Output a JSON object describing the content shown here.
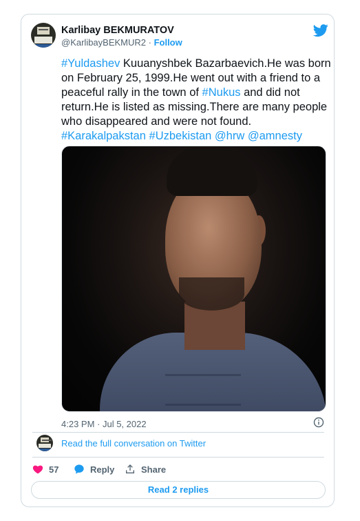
{
  "tweet": {
    "author_name": "Karlibay BEKMURATOV",
    "handle": "@KarlibayBEKMUR2",
    "separator": " · ",
    "follow_label": "Follow",
    "text_parts": [
      {
        "text": "#Yuldashev",
        "tag": true
      },
      {
        "text": " Kuuanyshbek Bazarbaevich.He was born on February 25, 1999.He went out with a friend to a peaceful rally in the town of ",
        "tag": false
      },
      {
        "text": "#Nukus",
        "tag": true
      },
      {
        "text": " and did not return.He is listed as missing.There are many people who disappeared and were not found. ",
        "tag": false
      },
      {
        "text": "#Karakalpakstan",
        "tag": true
      },
      {
        "text": " ",
        "tag": false
      },
      {
        "text": "#Uzbekistan",
        "tag": true
      },
      {
        "text": " ",
        "tag": false
      },
      {
        "text": "@hrw",
        "tag": true
      },
      {
        "text": " ",
        "tag": false
      },
      {
        "text": "@amnesty",
        "tag": true
      }
    ],
    "timestamp": "4:23 PM · Jul 5, 2022",
    "read_conversation": "Read the full conversation on Twitter",
    "like_count": "57",
    "reply_label": "Reply",
    "share_label": "Share",
    "read_replies": "Read 2 replies"
  },
  "colors": {
    "accent": "#1d9bf0",
    "like": "#f91880",
    "muted": "#536471"
  },
  "icons": [
    "twitter-bird-icon",
    "info-icon",
    "heart-icon",
    "reply-bubble-icon",
    "share-icon"
  ]
}
